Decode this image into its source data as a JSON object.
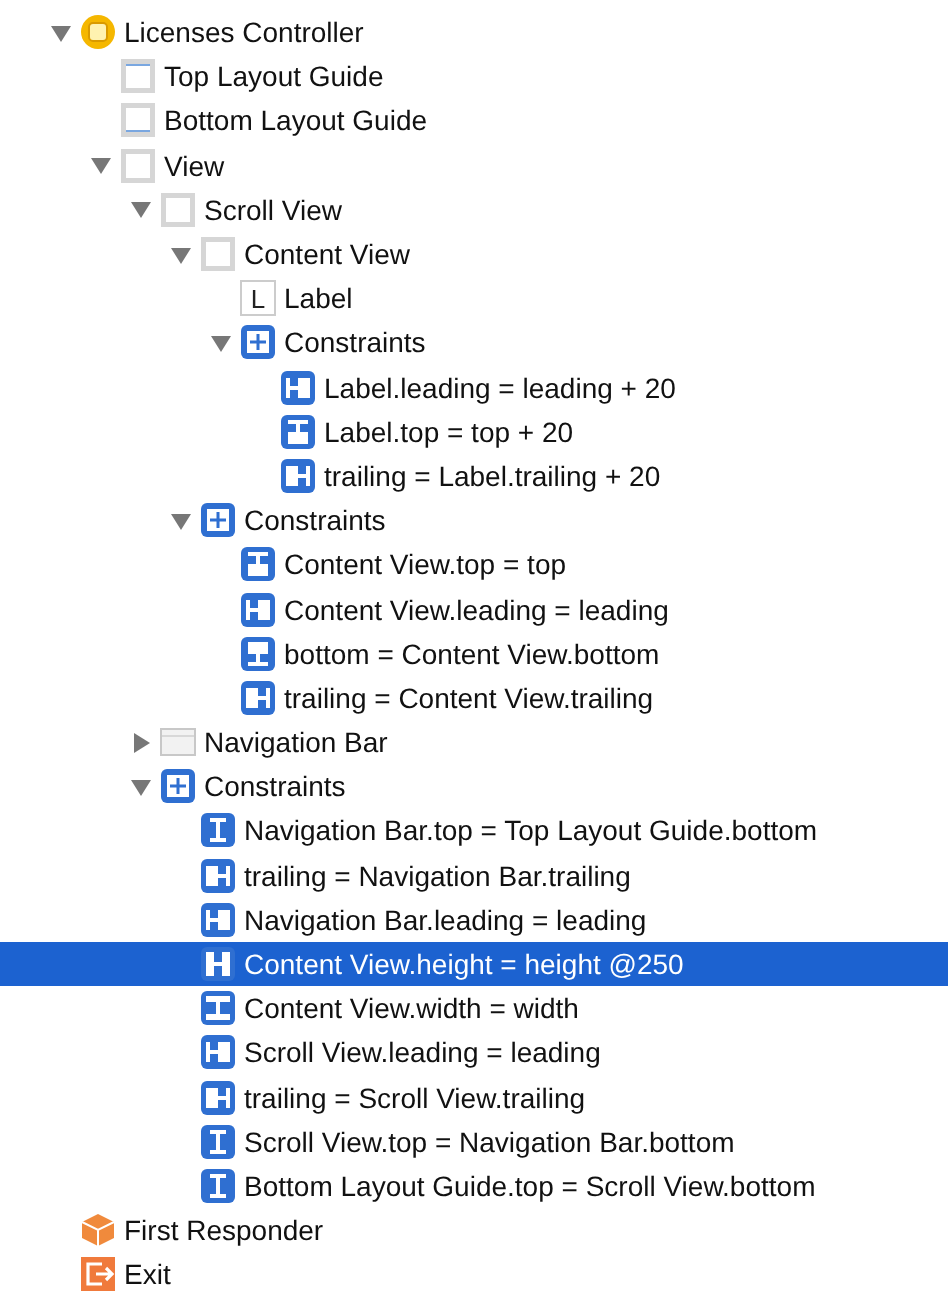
{
  "tree": [
    {
      "label": "Licenses Controller",
      "kind": "controller",
      "expanded": true,
      "selected": false,
      "children": [
        {
          "label": "Top Layout Guide",
          "kind": "guide-top",
          "selected": false
        },
        {
          "label": "Bottom Layout Guide",
          "kind": "guide-bottom",
          "selected": false
        },
        {
          "label": "View",
          "kind": "view",
          "expanded": true,
          "selected": false,
          "children": [
            {
              "label": "Scroll View",
              "kind": "view",
              "expanded": true,
              "selected": false,
              "children": [
                {
                  "label": "Content View",
                  "kind": "view",
                  "expanded": true,
                  "selected": false,
                  "children": [
                    {
                      "label": "Label",
                      "kind": "label",
                      "badge": "L",
                      "selected": false
                    },
                    {
                      "label": "Constraints",
                      "kind": "constraints",
                      "expanded": true,
                      "selected": false,
                      "children": [
                        {
                          "label": "Label.leading = leading + 20",
                          "kind": "leading",
                          "selected": false
                        },
                        {
                          "label": "Label.top = top + 20",
                          "kind": "top",
                          "selected": false
                        },
                        {
                          "label": "trailing = Label.trailing + 20",
                          "kind": "trailing",
                          "selected": false
                        }
                      ]
                    }
                  ]
                },
                {
                  "label": "Constraints",
                  "kind": "constraints",
                  "expanded": true,
                  "selected": false,
                  "children": [
                    {
                      "label": "Content View.top = top",
                      "kind": "top",
                      "selected": false
                    },
                    {
                      "label": "Content View.leading = leading",
                      "kind": "leading",
                      "selected": false
                    },
                    {
                      "label": "bottom = Content View.bottom",
                      "kind": "bottom",
                      "selected": false
                    },
                    {
                      "label": "trailing = Content View.trailing",
                      "kind": "trailing",
                      "selected": false
                    }
                  ]
                }
              ]
            },
            {
              "label": "Navigation Bar",
              "kind": "navbar",
              "expanded": false,
              "selected": false
            },
            {
              "label": "Constraints",
              "kind": "constraints",
              "expanded": true,
              "selected": false,
              "children": [
                {
                  "label": "Navigation Bar.top = Top Layout Guide.bottom",
                  "kind": "vertical",
                  "selected": false
                },
                {
                  "label": "trailing = Navigation Bar.trailing",
                  "kind": "trailing",
                  "selected": false
                },
                {
                  "label": "Navigation Bar.leading = leading",
                  "kind": "leading",
                  "selected": false
                },
                {
                  "label": "Content View.height = height @250",
                  "kind": "height",
                  "selected": true
                },
                {
                  "label": "Content View.width = width",
                  "kind": "width",
                  "selected": false
                },
                {
                  "label": "Scroll View.leading = leading",
                  "kind": "leading",
                  "selected": false
                },
                {
                  "label": "trailing = Scroll View.trailing",
                  "kind": "trailing",
                  "selected": false
                },
                {
                  "label": "Scroll View.top = Navigation Bar.bottom",
                  "kind": "vertical",
                  "selected": false
                },
                {
                  "label": "Bottom Layout Guide.top = Scroll View.bottom",
                  "kind": "vertical",
                  "selected": false
                }
              ]
            }
          ]
        }
      ]
    },
    {
      "label": "First Responder",
      "kind": "responder",
      "selected": false
    },
    {
      "label": "Exit",
      "kind": "exit",
      "selected": false
    }
  ]
}
